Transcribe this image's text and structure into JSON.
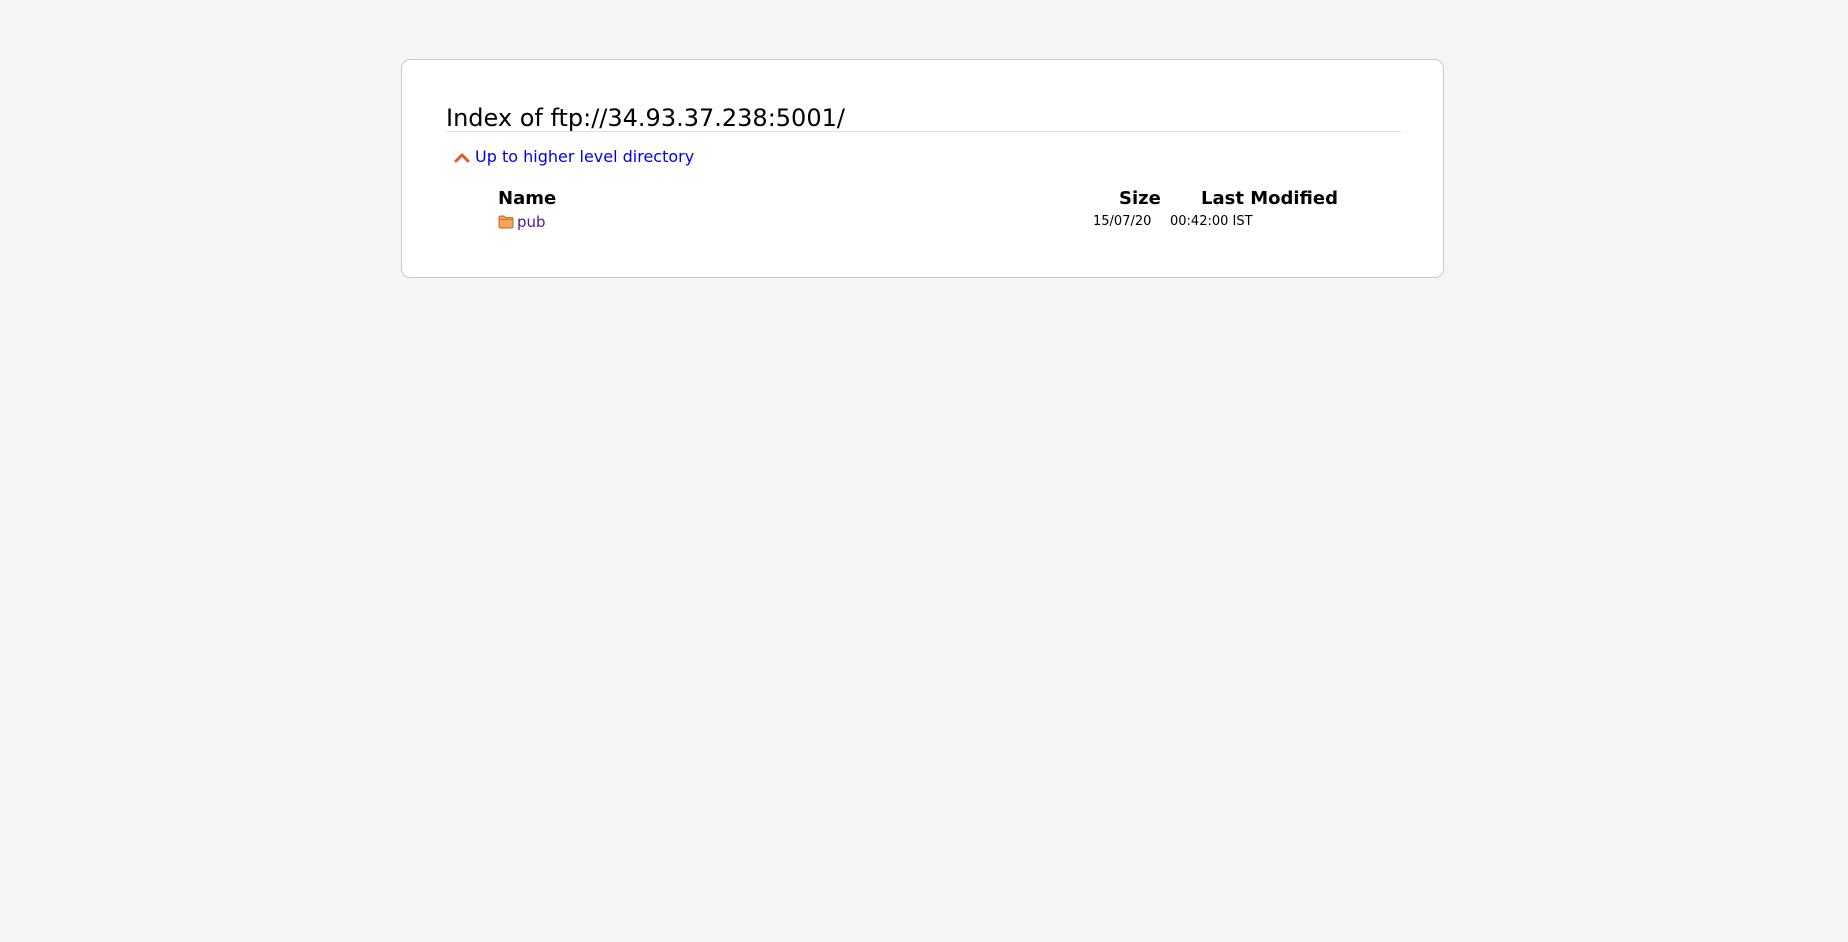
{
  "page": {
    "title": "Index of ftp://34.93.37.238:5001/",
    "up_link_label": "Up to higher level directory"
  },
  "columns": {
    "name": "Name",
    "size": "Size",
    "last_modified": "Last Modified"
  },
  "entries": [
    {
      "icon": "folder-icon",
      "name": "pub",
      "size": "",
      "date": "15/07/20",
      "time": "00:42:00 IST"
    }
  ],
  "colors": {
    "background": "#f4f5f7",
    "link": "#0000ee",
    "visited_link": "#551a8b",
    "up_arrow": "#e05a2b",
    "folder": "#f6a55b"
  }
}
